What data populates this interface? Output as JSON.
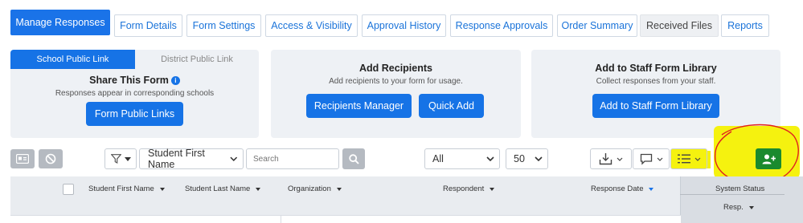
{
  "tabs": [
    {
      "label": "Manage Responses",
      "active": true
    },
    {
      "label": "Form Details"
    },
    {
      "label": "Form Settings"
    },
    {
      "label": "Access & Visibility"
    },
    {
      "label": "Approval History"
    },
    {
      "label": "Response Approvals"
    },
    {
      "label": "Order Summary"
    },
    {
      "label": "Received Files"
    },
    {
      "label": "Reports"
    }
  ],
  "public_links": {
    "switch_on": "School Public Link",
    "switch_off": "District Public Link",
    "title": "Share This Form",
    "info_icon": "i",
    "subtitle": "Responses appear in corresponding schools",
    "button": "Form Public Links"
  },
  "recipients": {
    "title": "Add Recipients",
    "subtitle": "Add recipients to your form for usage.",
    "manager_button": "Recipients Manager",
    "quick_add_button": "Quick Add"
  },
  "staff_library": {
    "title": "Add to Staff Form Library",
    "subtitle": "Collect responses from your staff.",
    "button": "Add to Staff Form Library"
  },
  "toolbar": {
    "filter_field": "Student First Name",
    "search_placeholder": "Search",
    "scope_select": "All",
    "page_size_select": "50",
    "icons": [
      "id-card-icon",
      "block-icon",
      "filter-icon",
      "search-icon",
      "download-icon",
      "comment-icon",
      "columns-icon",
      "add-user-icon"
    ]
  },
  "table": {
    "columns": [
      "Student First Name",
      "Student Last Name",
      "Organization",
      "Respondent",
      "Response Date",
      "System Status",
      "Resp."
    ]
  },
  "colors": {
    "primary": "#1673e6",
    "success": "#1a8a2e",
    "highlight": "#f5f20f",
    "annotation": "#e02020"
  }
}
